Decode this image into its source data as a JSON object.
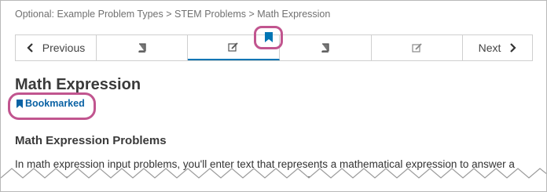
{
  "breadcrumb": "Optional: Example Problem Types > STEM Problems > Math Expression",
  "nav": {
    "previous_label": "Previous",
    "next_label": "Next",
    "units": [
      {
        "icon": "book-icon"
      },
      {
        "icon": "edit-icon",
        "active": true,
        "bookmarked": true
      },
      {
        "icon": "book-icon"
      },
      {
        "icon": "edit-icon"
      }
    ]
  },
  "page_title": "Math Expression",
  "bookmark_status": "Bookmarked",
  "section_heading": "Math Expression Problems",
  "body_text": "In math expression input problems, you'll enter text that represents a mathematical expression to answer a question. You'll enter the answer in plain text, and the system then converts your text to a symbolic expression",
  "colors": {
    "accent": "#0075b4",
    "bookmark_link": "#0a62a4",
    "highlight": "#c1558f"
  }
}
